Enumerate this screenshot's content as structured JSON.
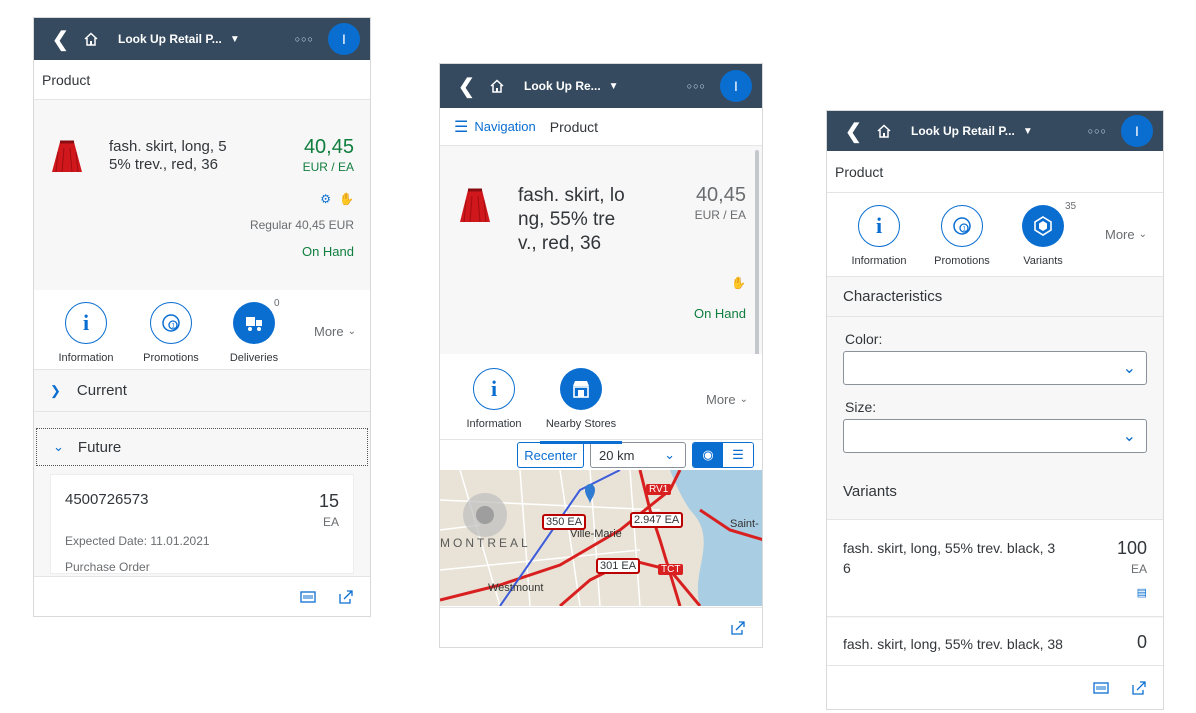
{
  "phone1": {
    "shell_title": "Look Up Retail P...",
    "avatar_letter": "I",
    "subheader": "Product",
    "product_name": "fash. skirt, long, 5\n5% trev., red, 36",
    "price": "40,45",
    "unit": "EUR / EA",
    "regular": "Regular 40,45 EUR",
    "status": "On Hand",
    "tabs": [
      {
        "label": "Information"
      },
      {
        "label": "Promotions"
      },
      {
        "label": "Deliveries",
        "count": "0"
      }
    ],
    "more": "More",
    "sections": [
      "Current",
      "Future"
    ],
    "delivery": {
      "order": "4500726573",
      "qty": "15",
      "unit": "EA",
      "expected": "Expected Date: 11.01.2021",
      "type": "Purchase Order"
    }
  },
  "phone2": {
    "shell_title": "Look Up Re...",
    "avatar_letter": "I",
    "nav_label": "Navigation",
    "subheader": "Product",
    "product_name": "fash. skirt, lo\nng, 55% tre\nv., red, 36",
    "price": "40,45",
    "unit": "EUR / EA",
    "status": "On Hand",
    "tabs": [
      {
        "label": "Information"
      },
      {
        "label": "Nearby Stores"
      }
    ],
    "more": "More",
    "recenter": "Recenter",
    "distance": "20 km",
    "map": {
      "pins": [
        "350 EA",
        "2.947 EA",
        "301 EA"
      ],
      "places": [
        "MONTREAL",
        "Westmount",
        "Saint-",
        "Ville-Marie",
        "RV1",
        "TCT"
      ]
    }
  },
  "phone3": {
    "shell_title": "Look Up Retail P...",
    "avatar_letter": "I",
    "subheader": "Product",
    "tabs": [
      {
        "label": "Information"
      },
      {
        "label": "Promotions"
      },
      {
        "label": "Variants",
        "count": "35"
      }
    ],
    "more": "More",
    "characteristics": "Characteristics",
    "color_label": "Color:",
    "size_label": "Size:",
    "variants_title": "Variants",
    "variants": [
      {
        "name": "fash. skirt, long, 55% trev. black, 3\n6",
        "qty": "100",
        "unit": "EA"
      },
      {
        "name": "fash. skirt, long, 55% trev. black, 38",
        "qty": "0",
        "unit": ""
      }
    ]
  },
  "colors": {
    "shell": "#354a5f",
    "accent": "#0a6ed1",
    "positive": "#107e3e",
    "pin": "#bb0000"
  }
}
